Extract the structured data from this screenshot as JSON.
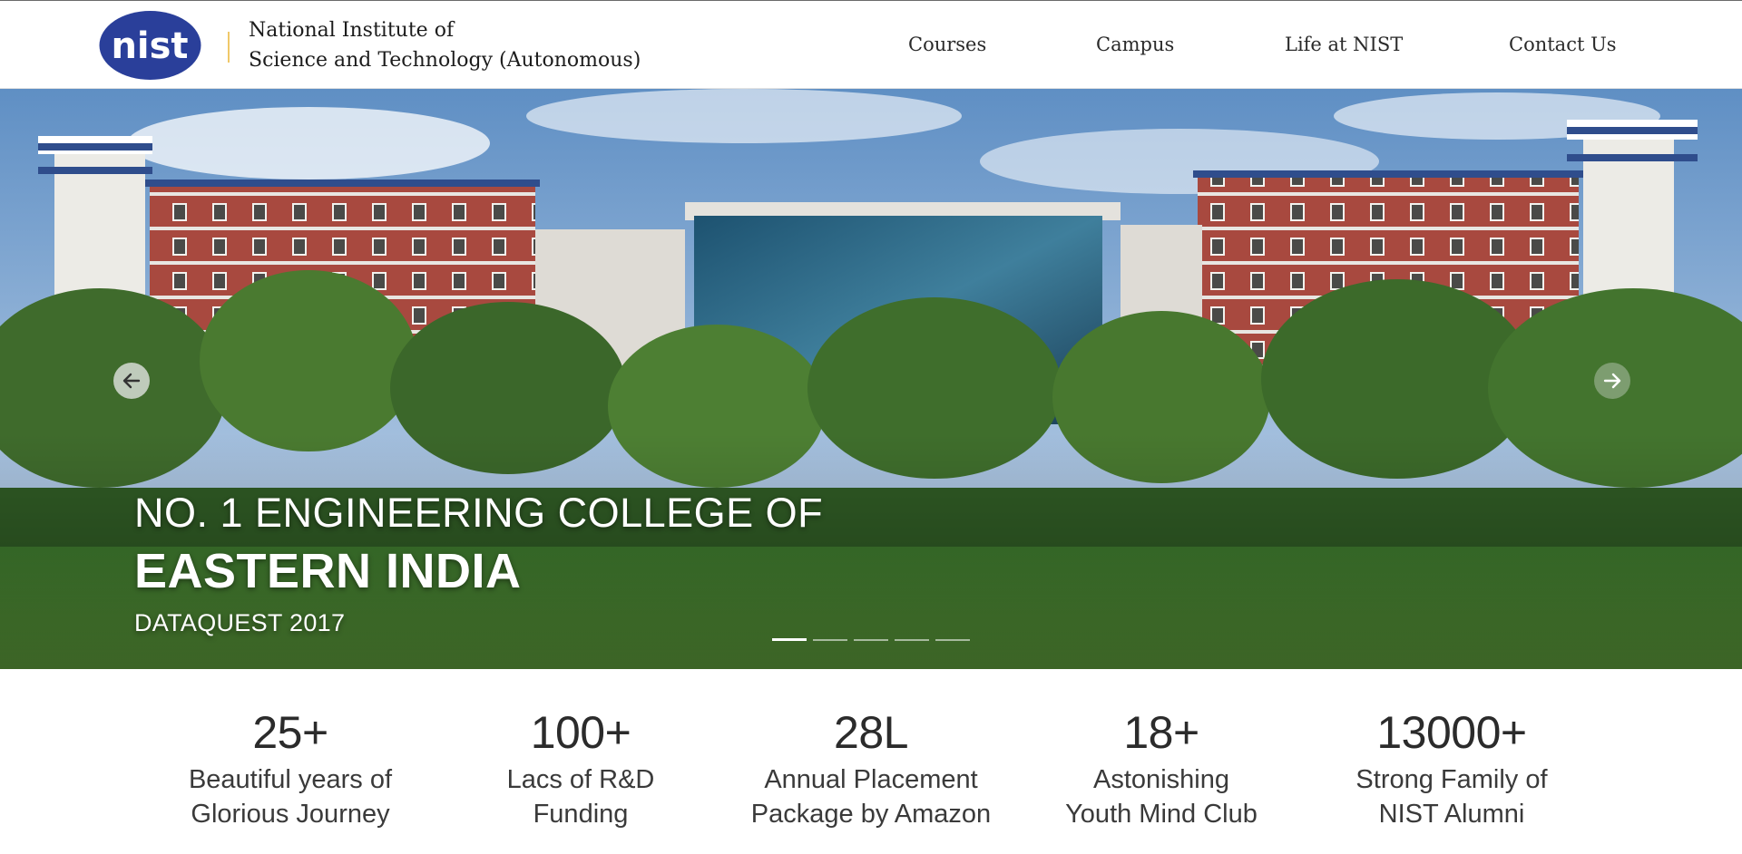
{
  "header": {
    "logo_text": "nist",
    "brand_line1": "National Institute of",
    "brand_line2": "Science and Technology (Autonomous)",
    "nav": [
      {
        "label": "Courses"
      },
      {
        "label": "Campus"
      },
      {
        "label": "Life at NIST"
      },
      {
        "label": "Contact Us"
      }
    ]
  },
  "hero": {
    "headline_line1": "NO. 1 ENGINEERING COLLEGE OF",
    "headline_line2": "EASTERN INDIA",
    "headline_line3": "DATAQUEST 2017",
    "prev_icon": "arrow-left-icon",
    "next_icon": "arrow-right-icon",
    "slide_count": 5,
    "active_slide": 1
  },
  "stats": [
    {
      "value": "25+",
      "label_line1": "Beautiful years of",
      "label_line2": "Glorious Journey"
    },
    {
      "value": "100+",
      "label_line1": "Lacs of R&D",
      "label_line2": "Funding"
    },
    {
      "value": "28L",
      "label_line1": "Annual Placement",
      "label_line2": "Package by Amazon"
    },
    {
      "value": "18+",
      "label_line1": "Astonishing",
      "label_line2": "Youth Mind Club"
    },
    {
      "value": "13000+",
      "label_line1": "Strong Family of",
      "label_line2": "NIST Alumni"
    }
  ],
  "colors": {
    "logo_blue": "#2a3f9a",
    "divider_gold": "#f0c869",
    "text_dark": "#2b2b2b"
  }
}
